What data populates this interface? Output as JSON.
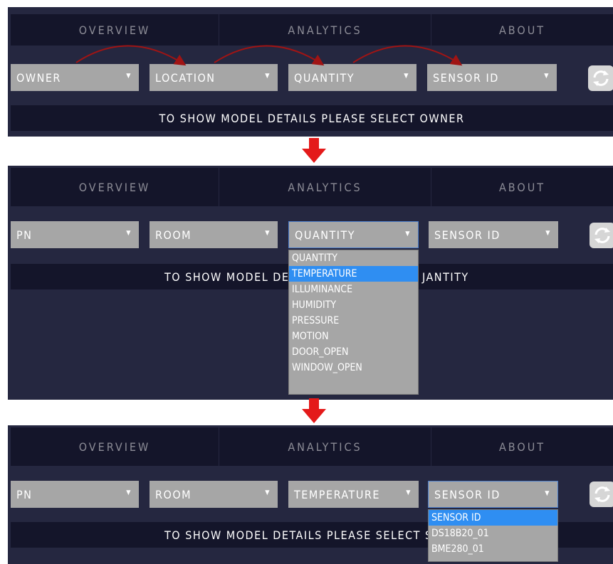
{
  "tabs": [
    "OVERVIEW",
    "ANALYTICS",
    "ABOUT"
  ],
  "step1": {
    "selects": [
      "OWNER",
      "LOCATION",
      "QUANTITY",
      "SENSOR ID"
    ],
    "message": "TO SHOW MODEL DETAILS PLEASE SELECT OWNER"
  },
  "step2": {
    "selects": [
      "PN",
      "ROOM",
      "QUANTITY",
      "SENSOR ID"
    ],
    "message_left": "TO SHOW MODEL DET",
    "message_right": "JANTITY",
    "dropdown": {
      "options": [
        "QUANTITY",
        "TEMPERATURE",
        "ILLUMINANCE",
        "HUMIDITY",
        "PRESSURE",
        "MOTION",
        "DOOR_OPEN",
        "WINDOW_OPEN"
      ],
      "highlighted_index": 1
    }
  },
  "step3": {
    "selects": [
      "PN",
      "ROOM",
      "TEMPERATURE",
      "SENSOR ID"
    ],
    "message": "TO SHOW MODEL DETAILS PLEASE SELECT SEN",
    "dropdown": {
      "options": [
        "SENSOR ID",
        "DS18B20_01",
        "BME280_01"
      ],
      "highlighted_index": 0
    }
  },
  "colors": {
    "panel_bg": "#252740",
    "bar_bg": "#14152a",
    "select_bg": "#a6a6a6",
    "highlight": "#2f8ef2",
    "arrow_red": "#e41a1a",
    "curve_red": "#a01414"
  },
  "icons": [
    "caret-down-icon",
    "refresh-icon",
    "down-arrow-icon",
    "curved-arrow-icon"
  ]
}
